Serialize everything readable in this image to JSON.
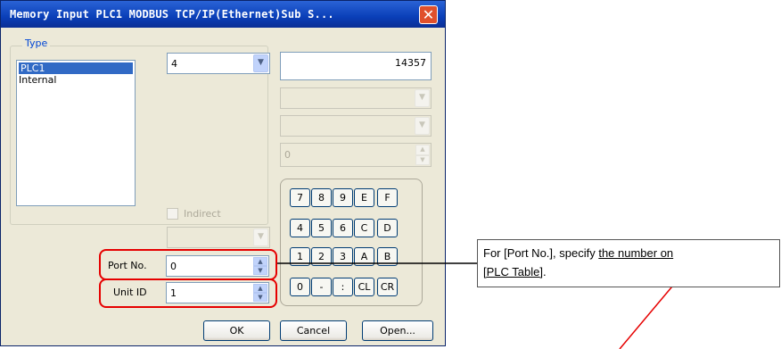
{
  "window": {
    "title": "Memory Input  PLC1 MODBUS TCP/IP(Ethernet)Sub S...",
    "close_glyph": "✕"
  },
  "type_group": {
    "label": "Type",
    "items": [
      "PLC1",
      "Internal"
    ],
    "selected": "PLC1"
  },
  "device_select": {
    "value": "4"
  },
  "address_field": {
    "value": "14357"
  },
  "disabled_field": {
    "value": "0"
  },
  "indirect": {
    "label": "Indirect"
  },
  "port": {
    "label": "Port No.",
    "value": "0"
  },
  "unit": {
    "label": "Unit ID",
    "value": "1"
  },
  "keypad": {
    "keys": [
      "7",
      "8",
      "9",
      "E",
      "F",
      "4",
      "5",
      "6",
      "C",
      "D",
      "1",
      "2",
      "3",
      "A",
      "B",
      "0",
      "-",
      ":",
      "CL",
      "CR"
    ]
  },
  "buttons": {
    "ok": "OK",
    "cancel": "Cancel",
    "open": "Open..."
  },
  "callout": {
    "prefix": "For [Port No.], specify ",
    "underlined_1": "the number on",
    "underlined_2": "[PLC Table]",
    "suffix": "."
  },
  "colors": {
    "titlebar": "#0a3fb8",
    "highlight": "#e60000",
    "dialog_bg": "#ece9d8"
  }
}
